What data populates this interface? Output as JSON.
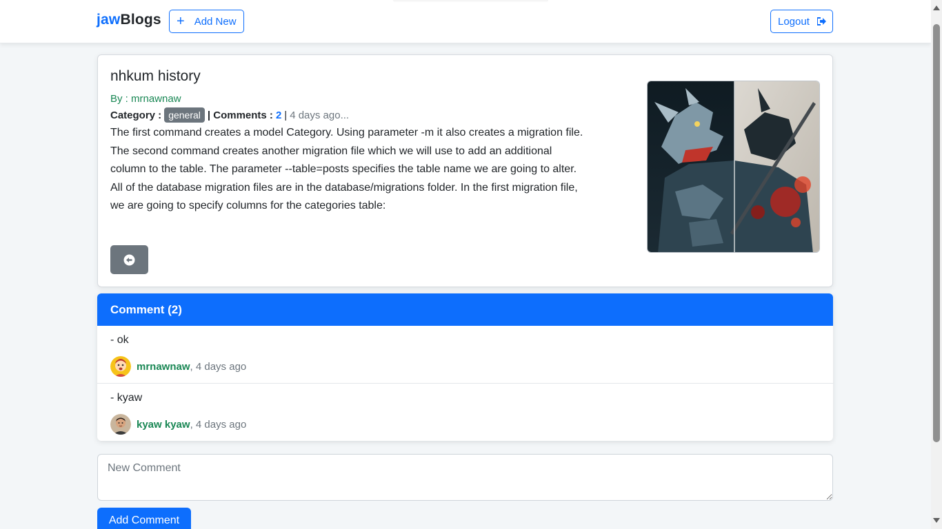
{
  "navbar": {
    "brand_part1": "jaw",
    "brand_part2": "Blogs",
    "add_new_label": "Add New",
    "logout_label": "Logout"
  },
  "post": {
    "title": "nhkum history",
    "author": "By : mrnawnaw",
    "category_label": "Category :",
    "category": "general",
    "comments_label": "| Comments :",
    "comments_count": "2",
    "separator": "|",
    "time": "4 days ago...",
    "body": "The first command creates a model Category. Using parameter -m it also creates a migration file. The second command creates another migration file which we will use to add an additional column to the table. The parameter --table=posts specifies the table name we are going to alter. All of the database migration files are in the database/migrations folder. In the first migration file, we are going to specify columns for the categories table:"
  },
  "comments": {
    "header": "Comment (2)",
    "items": [
      {
        "text": "- ok",
        "user": "mrnawnaw",
        "time": ", 4 days ago"
      },
      {
        "text": "- kyaw",
        "user": "kyaw kyaw",
        "time": ", 4 days ago"
      }
    ]
  },
  "new_comment": {
    "placeholder": "New Comment",
    "submit_label": "Add Comment"
  },
  "colors": {
    "primary": "#0d6efd",
    "success": "#198754",
    "secondary": "#6c757d"
  }
}
